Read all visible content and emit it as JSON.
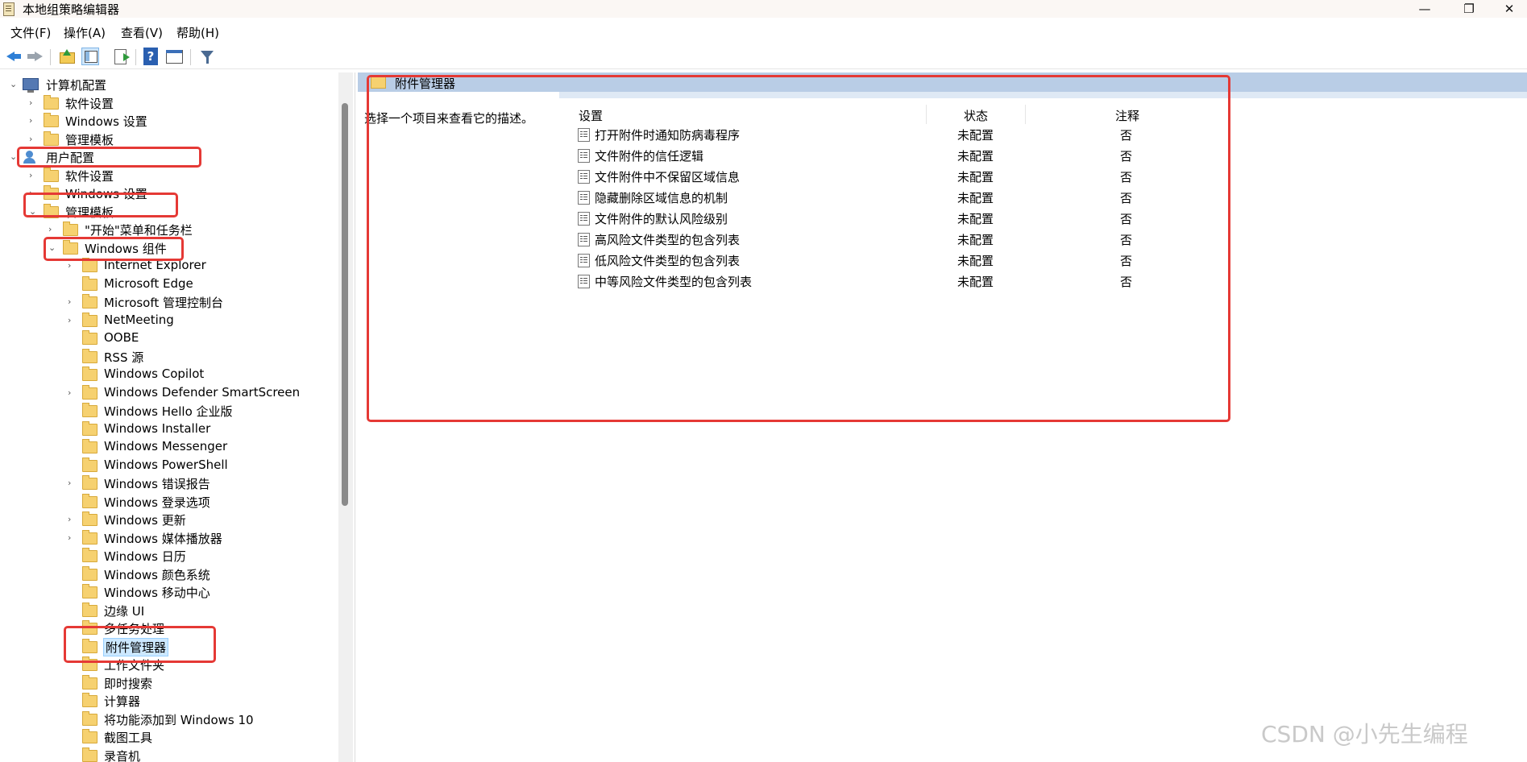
{
  "window": {
    "title": "本地组策略编辑器",
    "controls": [
      "—",
      "❐",
      "✕"
    ]
  },
  "menu": [
    "文件(F)",
    "操作(A)",
    "查看(V)",
    "帮助(H)"
  ],
  "toolbar": {
    "buttons": [
      "back-icon",
      "forward-icon",
      "up-folder-icon",
      "show-hide-tree-icon",
      "export-list-icon",
      "help-icon",
      "properties-icon",
      "filter-icon"
    ]
  },
  "tree": [
    {
      "label": "计算机配置",
      "icon": "computer",
      "chev": "⌄"
    },
    {
      "label": "软件设置",
      "icon": "folder",
      "chev": "›"
    },
    {
      "label": "Windows 设置",
      "icon": "folder",
      "chev": "›"
    },
    {
      "label": "管理模板",
      "icon": "folder",
      "chev": "›"
    },
    {
      "label": "用户配置",
      "icon": "user",
      "chev": "⌄"
    },
    {
      "label": "软件设置",
      "icon": "folder",
      "chev": "›"
    },
    {
      "label": "Windows 设置",
      "icon": "folder",
      "chev": "›"
    },
    {
      "label": "管理模板",
      "icon": "folder",
      "chev": "⌄"
    },
    {
      "label": "\"开始\"菜单和任务栏",
      "icon": "folder",
      "chev": "›"
    },
    {
      "label": "Windows 组件",
      "icon": "folder",
      "chev": "⌄"
    },
    {
      "label": "Internet Explorer",
      "icon": "folder",
      "chev": "›"
    },
    {
      "label": "Microsoft Edge",
      "icon": "folder",
      "chev": ""
    },
    {
      "label": "Microsoft 管理控制台",
      "icon": "folder",
      "chev": "›"
    },
    {
      "label": "NetMeeting",
      "icon": "folder",
      "chev": "›"
    },
    {
      "label": "OOBE",
      "icon": "folder",
      "chev": ""
    },
    {
      "label": "RSS 源",
      "icon": "folder",
      "chev": ""
    },
    {
      "label": "Windows Copilot",
      "icon": "folder",
      "chev": ""
    },
    {
      "label": "Windows Defender SmartScreen",
      "icon": "folder",
      "chev": "›"
    },
    {
      "label": "Windows Hello 企业版",
      "icon": "folder",
      "chev": ""
    },
    {
      "label": "Windows Installer",
      "icon": "folder",
      "chev": ""
    },
    {
      "label": "Windows Messenger",
      "icon": "folder",
      "chev": ""
    },
    {
      "label": "Windows PowerShell",
      "icon": "folder",
      "chev": ""
    },
    {
      "label": "Windows 错误报告",
      "icon": "folder",
      "chev": "›"
    },
    {
      "label": "Windows 登录选项",
      "icon": "folder",
      "chev": ""
    },
    {
      "label": "Windows 更新",
      "icon": "folder",
      "chev": "›"
    },
    {
      "label": "Windows 媒体播放器",
      "icon": "folder",
      "chev": "›"
    },
    {
      "label": "Windows 日历",
      "icon": "folder",
      "chev": ""
    },
    {
      "label": "Windows 颜色系统",
      "icon": "folder",
      "chev": ""
    },
    {
      "label": "Windows 移动中心",
      "icon": "folder",
      "chev": ""
    },
    {
      "label": "边缘 UI",
      "icon": "folder",
      "chev": ""
    },
    {
      "label": "多任务处理",
      "icon": "folder",
      "chev": ""
    },
    {
      "label": "附件管理器",
      "icon": "folder",
      "chev": "",
      "selected": true
    },
    {
      "label": "工作文件夹",
      "icon": "folder",
      "chev": ""
    },
    {
      "label": "即时搜索",
      "icon": "folder",
      "chev": ""
    },
    {
      "label": "计算器",
      "icon": "folder",
      "chev": ""
    },
    {
      "label": "将功能添加到 Windows 10",
      "icon": "folder",
      "chev": ""
    },
    {
      "label": "截图工具",
      "icon": "folder",
      "chev": ""
    },
    {
      "label": "录音机",
      "icon": "folder",
      "chev": ""
    }
  ],
  "details": {
    "header": "附件管理器",
    "description": "选择一个项目来查看它的描述。",
    "columns": [
      "设置",
      "状态",
      "注释"
    ],
    "rows": [
      {
        "name": "打开附件时通知防病毒程序",
        "state": "未配置",
        "note": "否"
      },
      {
        "name": "文件附件的信任逻辑",
        "state": "未配置",
        "note": "否"
      },
      {
        "name": "文件附件中不保留区域信息",
        "state": "未配置",
        "note": "否"
      },
      {
        "name": "隐藏删除区域信息的机制",
        "state": "未配置",
        "note": "否"
      },
      {
        "name": "文件附件的默认风险级别",
        "state": "未配置",
        "note": "否"
      },
      {
        "name": "高风险文件类型的包含列表",
        "state": "未配置",
        "note": "否"
      },
      {
        "name": "低风险文件类型的包含列表",
        "state": "未配置",
        "note": "否"
      },
      {
        "name": "中等风险文件类型的包含列表",
        "state": "未配置",
        "note": "否"
      }
    ]
  },
  "watermark": "CSDN @小先生编程",
  "colors": {
    "annotation": "#e53935",
    "selection": "#cce8ff",
    "header": "#b9cde6"
  }
}
